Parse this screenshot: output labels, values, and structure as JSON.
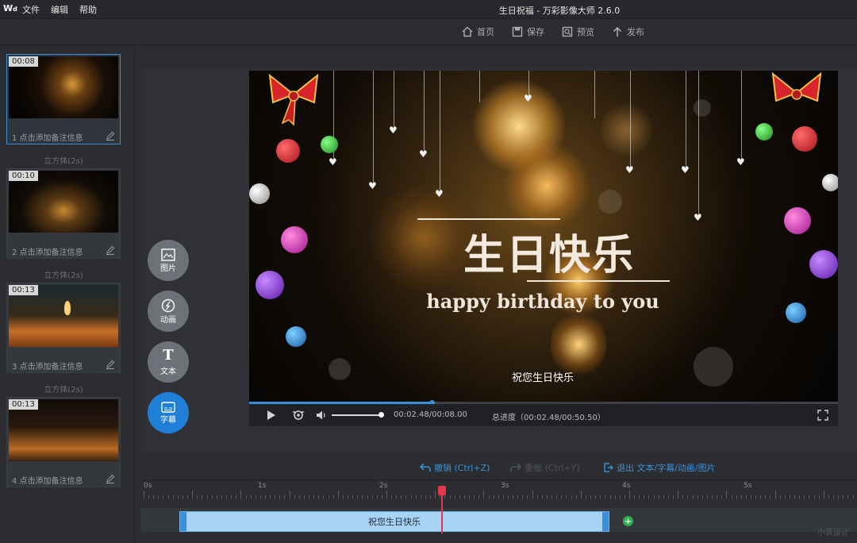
{
  "app": {
    "logo_text": "W",
    "menu": [
      "文件",
      "编辑",
      "帮助"
    ],
    "window_title": "生日祝福 - 万彩影像大师 2.6.0"
  },
  "toolbar": {
    "home": "首页",
    "save": "保存",
    "preview": "预览",
    "publish": "发布"
  },
  "scenes": [
    {
      "duration": "00:08",
      "note": "1  点击添加备注信息"
    },
    {
      "duration": "00:10",
      "note": "2  点击添加备注信息"
    },
    {
      "duration": "00:13",
      "note": "3  点击添加备注信息"
    },
    {
      "duration": "00:13",
      "note": "4  点击添加备注信息"
    }
  ],
  "transitions": [
    "立方体(2s)",
    "立方体(2s)",
    "立方体(2s)"
  ],
  "tools": {
    "image": "图片",
    "animation": "动画",
    "text": "文本",
    "subtitle": "字幕"
  },
  "video": {
    "title": "生日快乐",
    "subtitle": "happy birthday to you",
    "caption": "祝您生日快乐"
  },
  "player": {
    "time": "00:02.48/00:08.00",
    "total": "总进度（00:02.48/00:50.50）",
    "progress": 0.31
  },
  "timeline": {
    "undo": "撤销 (Ctrl+Z)",
    "redo": "重做 (Ctrl+Y)",
    "export": "退出 文本/字幕/动画/图片",
    "ruler_labels": [
      "0s",
      "1s",
      "2s",
      "3s",
      "4s",
      "5s"
    ],
    "clip_label": "祝您生日快乐",
    "add": "+",
    "watermark": "小筑设计"
  },
  "colors": {
    "accent": "#3b8fd9",
    "playhead": "#e03a4a",
    "add": "#2fb24f"
  }
}
